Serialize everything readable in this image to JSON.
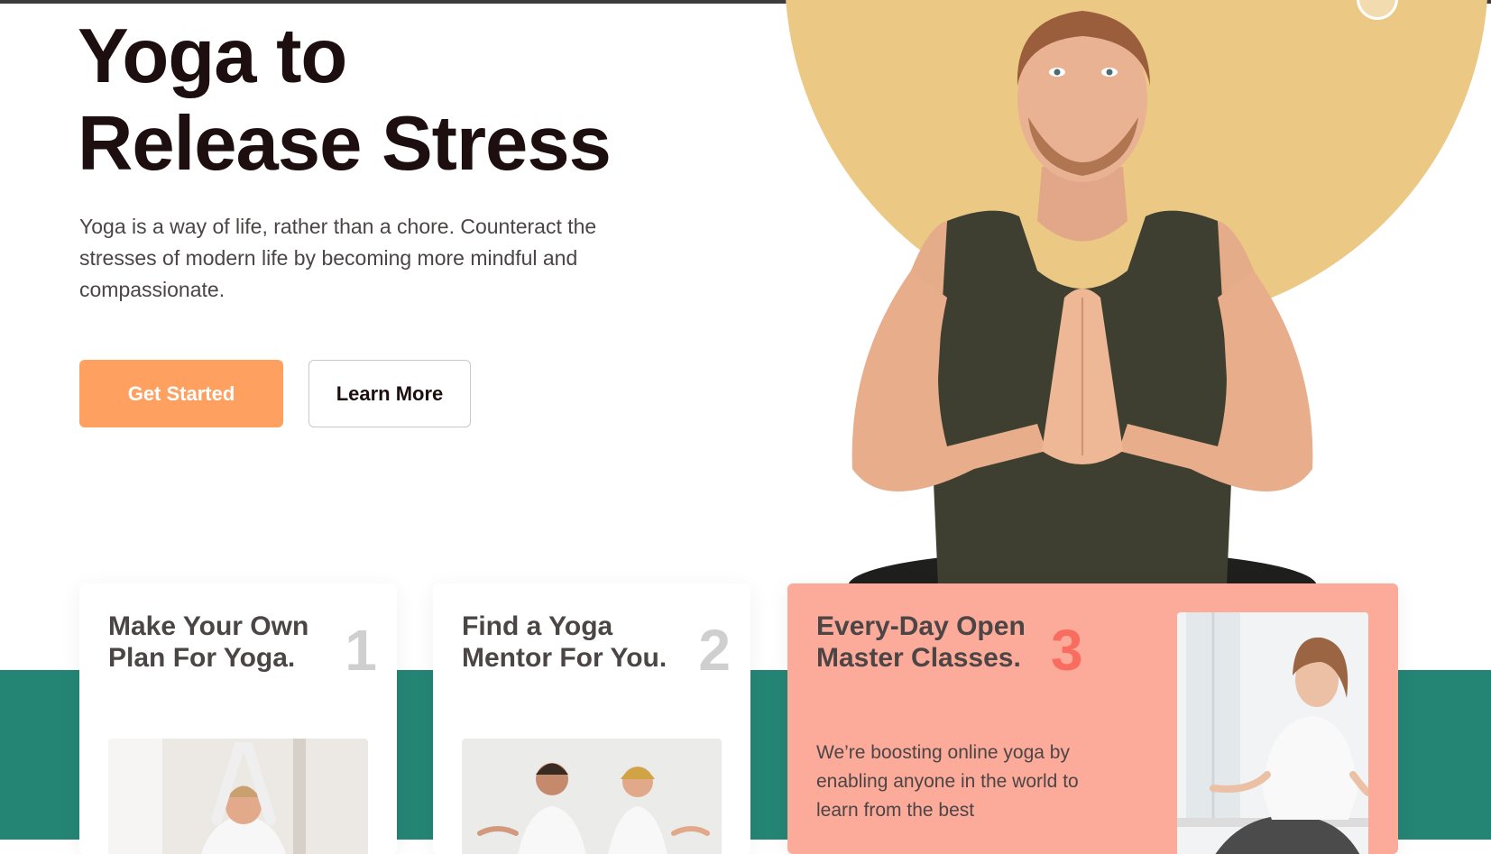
{
  "hero": {
    "title_line1": "Yoga to",
    "title_line2": "Release Stress",
    "description": "Yoga is a way of life, rather than a chore. Counteract the stresses of modern life by becoming more mindful and compassionate.",
    "primary_button": "Get Started",
    "secondary_button": "Learn More"
  },
  "cards": [
    {
      "title": "Make Your Own Plan For Yoga.",
      "number": "1"
    },
    {
      "title": "Find a Yoga Mentor For You.",
      "number": "2"
    },
    {
      "title": "Every-Day Open Master Classes.",
      "number": "3",
      "text": "We’re boosting online yoga by enabling anyone in the world to learn from the best"
    }
  ],
  "colors": {
    "accent_orange": "#fda060",
    "sun_yellow": "#ecc885",
    "band_teal": "#258575",
    "highlight_card": "#fcaa9a",
    "highlight_number": "#f86d5f"
  }
}
